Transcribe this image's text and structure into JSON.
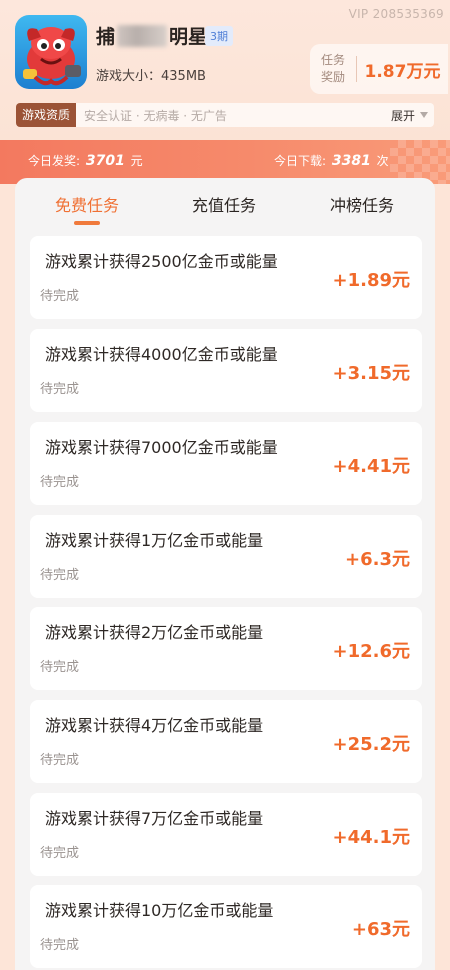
{
  "header": {
    "vip_label": "VIP 208535369",
    "game_title_start": "捕",
    "game_title_end": "明星",
    "period": "3期",
    "size_text": "游戏大小：435MB",
    "reward_label_line1": "任务",
    "reward_label_line2": "奖励",
    "reward_value": "1.87万元"
  },
  "qualification": {
    "tag": "游戏资质",
    "text": "安全认证 · 无病毒 · 无广告",
    "expand": "展开"
  },
  "stats": {
    "bonus_label": "今日发奖:",
    "bonus_value": "3701",
    "bonus_unit": "元",
    "download_label": "今日下载:",
    "download_value": "3381",
    "download_unit": "次"
  },
  "tabs": [
    {
      "label": "免费任务",
      "active": true
    },
    {
      "label": "充值任务",
      "active": false
    },
    {
      "label": "冲榜任务",
      "active": false
    }
  ],
  "tasks": [
    {
      "title": "游戏累计获得2500亿金币或能量",
      "status": "待完成",
      "reward": "+1.89元"
    },
    {
      "title": "游戏累计获得4000亿金币或能量",
      "status": "待完成",
      "reward": "+3.15元"
    },
    {
      "title": "游戏累计获得7000亿金币或能量",
      "status": "待完成",
      "reward": "+4.41元"
    },
    {
      "title": "游戏累计获得1万亿金币或能量",
      "status": "待完成",
      "reward": "+6.3元"
    },
    {
      "title": "游戏累计获得2万亿金币或能量",
      "status": "待完成",
      "reward": "+12.6元"
    },
    {
      "title": "游戏累计获得4万亿金币或能量",
      "status": "待完成",
      "reward": "+25.2元"
    },
    {
      "title": "游戏累计获得7万亿金币或能量",
      "status": "待完成",
      "reward": "+44.1元"
    },
    {
      "title": "游戏累计获得10万亿金币或能量",
      "status": "待完成",
      "reward": "+63元"
    }
  ],
  "colors": {
    "accent": "#f06a2b",
    "stats_bar": "#f3795f",
    "qual_tag": "#9b5336",
    "period_badge": "#4f7fd6"
  }
}
